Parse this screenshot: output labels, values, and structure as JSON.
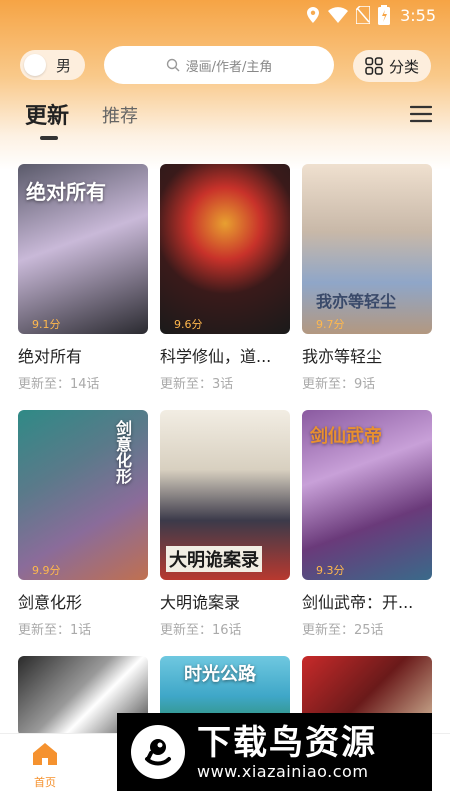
{
  "status_bar": {
    "time": "3:55"
  },
  "header": {
    "gender_label": "男",
    "search_placeholder": "漫画/作者/主角",
    "category_label": "分类"
  },
  "tabs": [
    {
      "label": "更新",
      "active": true
    },
    {
      "label": "推荐",
      "active": false
    }
  ],
  "comics": [
    {
      "name": "绝对所有",
      "update": "更新至：14话",
      "score": "9.1分",
      "cover_text": "绝对所有",
      "colors": [
        "#3a3a4a",
        "#c9b9d8",
        "#2a2a30"
      ]
    },
    {
      "name": "科学修仙，道...",
      "update": "更新至：3话",
      "score": "9.6分",
      "cover_text": "",
      "colors": [
        "#1a1a1a",
        "#c8322a",
        "#3a3a3a"
      ]
    },
    {
      "name": "我亦等轻尘",
      "update": "更新至：9话",
      "score": "9.7分",
      "cover_text": "我亦等轻尘",
      "colors": [
        "#e9d6c4",
        "#8fa6c8",
        "#b39880"
      ]
    },
    {
      "name": "剑意化形",
      "update": "更新至：1话",
      "score": "9.9分",
      "cover_text": "剑意化形",
      "colors": [
        "#2f8a86",
        "#8a6c9a",
        "#c07050"
      ]
    },
    {
      "name": "大明诡案录",
      "update": "更新至：16话",
      "score": "",
      "cover_text": "大明诡案录",
      "colors": [
        "#f2ede3",
        "#3c3a4a",
        "#b8392f"
      ]
    },
    {
      "name": "剑仙武帝：开...",
      "update": "更新至：25话",
      "score": "9.3分",
      "cover_text": "剑仙武帝",
      "colors": [
        "#6a3a7a",
        "#c8a0d8",
        "#3a6a8a"
      ]
    },
    {
      "name": "",
      "update": "",
      "score": "",
      "cover_text": "",
      "colors": [
        "#3a3a3a",
        "#9a9a9a",
        "#ffffff"
      ]
    },
    {
      "name": "",
      "update": "",
      "score": "",
      "cover_text": "时光公路",
      "colors": [
        "#3fa7c8",
        "#6fc8e0",
        "#2a8a5a"
      ]
    },
    {
      "name": "",
      "update": "",
      "score": "",
      "cover_text": "",
      "colors": [
        "#c82a2a",
        "#6a1a1a",
        "#d8c0a0"
      ]
    }
  ],
  "bottom_nav": {
    "home_label": "首页"
  },
  "watermark": {
    "title": "下载鸟资源",
    "url": "www.xiazainiao.com"
  }
}
